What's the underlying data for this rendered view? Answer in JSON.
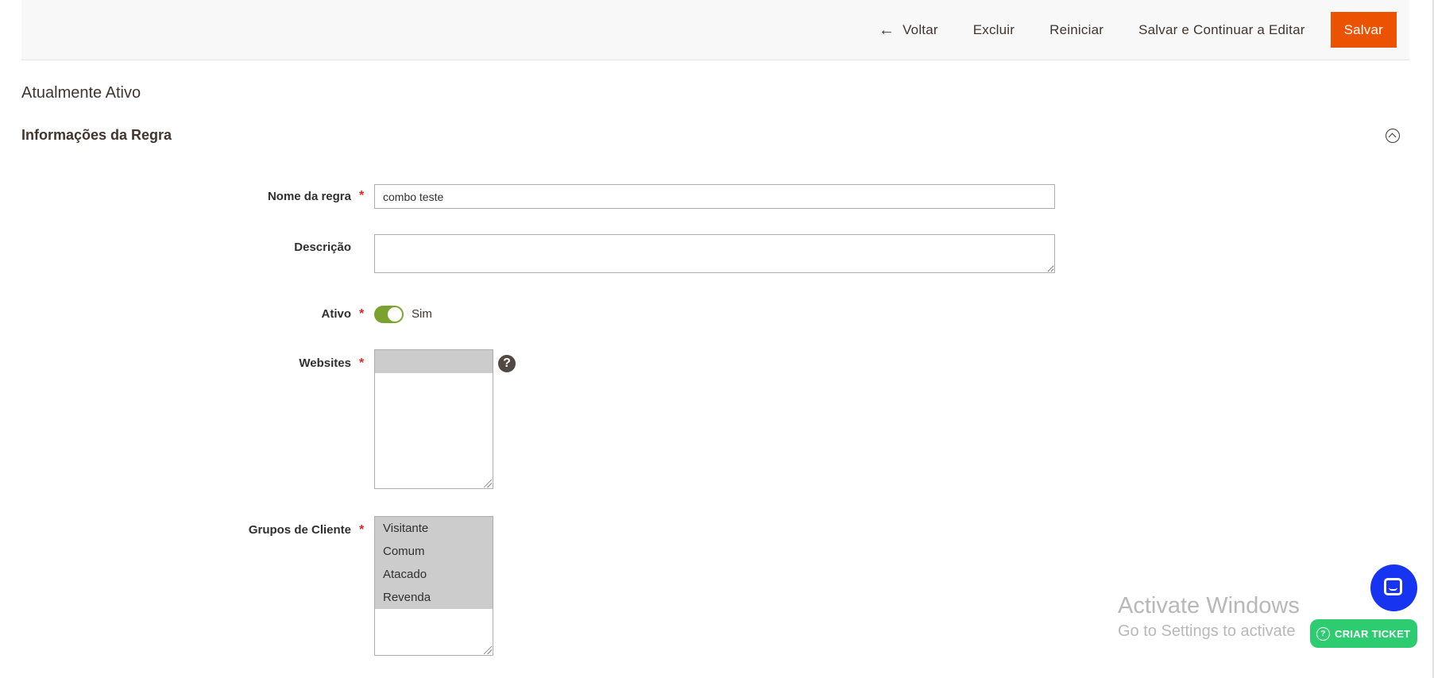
{
  "actions": {
    "back_label": "Voltar",
    "delete_label": "Excluir",
    "reset_label": "Reiniciar",
    "save_continue_label": "Salvar e Continuar a Editar",
    "save_label": "Salvar"
  },
  "status": "Atualmente Ativo",
  "section": {
    "title": "Informações da Regra"
  },
  "form": {
    "rule_name": {
      "label": "Nome da regra",
      "value": "combo teste",
      "required": "*"
    },
    "description": {
      "label": "Descrição",
      "value": ""
    },
    "active": {
      "label": "Ativo",
      "required": "*",
      "value_label": "Sim"
    },
    "websites": {
      "label": "Websites",
      "required": "*",
      "options": [
        ""
      ]
    },
    "customer_groups": {
      "label": "Grupos de Cliente",
      "required": "*",
      "options": [
        "Visitante",
        "Comum",
        "Atacado",
        "Revenda"
      ]
    }
  },
  "overlay": {
    "watermark_title": "Activate Windows",
    "watermark_sub": "Go to Settings to activate",
    "ticket_label": "CRIAR TICKET"
  },
  "colors": {
    "primary": "#eb5202",
    "toggle_on": "#79a22e",
    "chat": "#1735f0",
    "ticket": "#2ecc71",
    "required": "#e22626"
  }
}
